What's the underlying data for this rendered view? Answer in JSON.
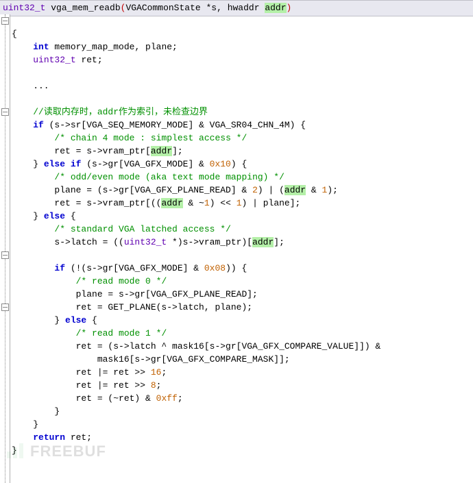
{
  "title": {
    "ty": "uint32_t",
    "sp1": " ",
    "fn": "vga_mem_readb",
    "open": "(",
    "arg1": "VGACommonState *s, hwaddr ",
    "hl": "addr",
    "close": ")"
  },
  "lines": {
    "l01": "{",
    "l02a": "    ",
    "l02b": "int",
    "l02c": " memory_map_mode, plane;",
    "l03a": "    ",
    "l03b": "uint32_t",
    "l03c": " ret;",
    "l04": "",
    "l05": "    ...",
    "l06": "",
    "l07a": "    ",
    "l07b": "//读取内存时，addr作为索引，未检查边界",
    "l08a": "    ",
    "l08b": "if",
    "l08c": " (s->sr[VGA_SEQ_MEMORY_MODE] & VGA_SR04_CHN_4M) {",
    "l09a": "        ",
    "l09b": "/* chain 4 mode : simplest access */",
    "l10a": "        ret = s->vram_ptr[",
    "l10b": "addr",
    "l10c": "];",
    "l11a": "    } ",
    "l11b": "else if",
    "l11c": " (s->gr[VGA_GFX_MODE] & ",
    "l11d": "0x10",
    "l11e": ") {",
    "l12a": "        ",
    "l12b": "/* odd/even mode (aka text mode mapping) */",
    "l13a": "        plane = (s->gr[VGA_GFX_PLANE_READ] & ",
    "l13b": "2",
    "l13c": ") | (",
    "l13d": "addr",
    "l13e": " & ",
    "l13f": "1",
    "l13g": ");",
    "l14a": "        ret = s->vram_ptr[((",
    "l14b": "addr",
    "l14c": " & ~",
    "l14d": "1",
    "l14e": ") << ",
    "l14f": "1",
    "l14g": ") | plane];",
    "l15a": "    } ",
    "l15b": "else",
    "l15c": " {",
    "l16a": "        ",
    "l16b": "/* standard VGA latched access */",
    "l17a": "        s->latch = ((",
    "l17b": "uint32_t",
    "l17c": " *)s->vram_ptr)[",
    "l17d": "addr",
    "l17e": "];",
    "l18": "",
    "l19a": "        ",
    "l19b": "if",
    "l19c": " (!(s->gr[VGA_GFX_MODE] & ",
    "l19d": "0x08",
    "l19e": ")) {",
    "l20a": "            ",
    "l20b": "/* read mode 0 */",
    "l21": "            plane = s->gr[VGA_GFX_PLANE_READ];",
    "l22": "            ret = GET_PLANE(s->latch, plane);",
    "l23a": "        } ",
    "l23b": "else",
    "l23c": " {",
    "l24a": "            ",
    "l24b": "/* read mode 1 */",
    "l25": "            ret = (s->latch ^ mask16[s->gr[VGA_GFX_COMPARE_VALUE]]) &",
    "l26": "                mask16[s->gr[VGA_GFX_COMPARE_MASK]];",
    "l27a": "            ret |= ret >> ",
    "l27b": "16",
    "l27c": ";",
    "l28a": "            ret |= ret >> ",
    "l28b": "8",
    "l28c": ";",
    "l29a": "            ret = (~ret) & ",
    "l29b": "0xff",
    "l29c": ";",
    "l30": "        }",
    "l31": "    }",
    "l32a": "    ",
    "l32b": "return",
    "l32c": " ret;",
    "l33": "}"
  },
  "watermark": "FREEBUF"
}
